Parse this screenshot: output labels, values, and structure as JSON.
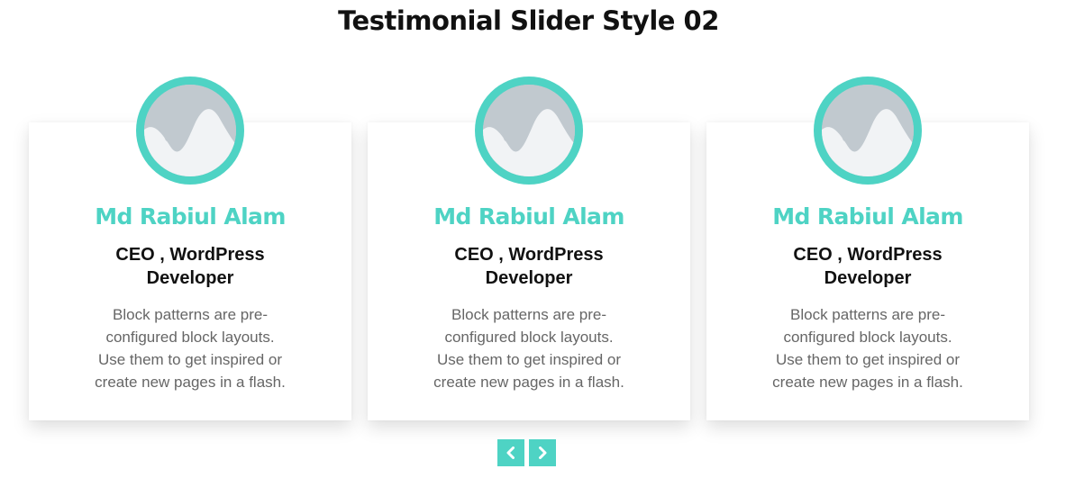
{
  "page": {
    "title": "Testimonial Slider Style 02"
  },
  "colors": {
    "accent": "#4ed3c4",
    "text_dark": "#111111",
    "text_muted": "#666666",
    "avatar_placeholder": "#c1c9cf"
  },
  "slider": {
    "cards": [
      {
        "name": "Md Rabiul Alam",
        "role": "CEO , WordPress Developer",
        "description": "Block patterns are pre-configured block layouts. Use them to get inspired or create new pages in a flash.",
        "avatar_icon": "image-placeholder-icon"
      },
      {
        "name": "Md Rabiul Alam",
        "role": "CEO , WordPress Developer",
        "description": "Block patterns are pre-configured block layouts. Use them to get inspired or create new pages in a flash.",
        "avatar_icon": "image-placeholder-icon"
      },
      {
        "name": "Md Rabiul Alam",
        "role": "CEO , WordPress Developer",
        "description": "Block patterns are pre-configured block layouts. Use them to get inspired or create new pages in a flash.",
        "avatar_icon": "image-placeholder-icon"
      }
    ],
    "nav": {
      "prev_icon": "chevron-left-icon",
      "next_icon": "chevron-right-icon"
    }
  }
}
